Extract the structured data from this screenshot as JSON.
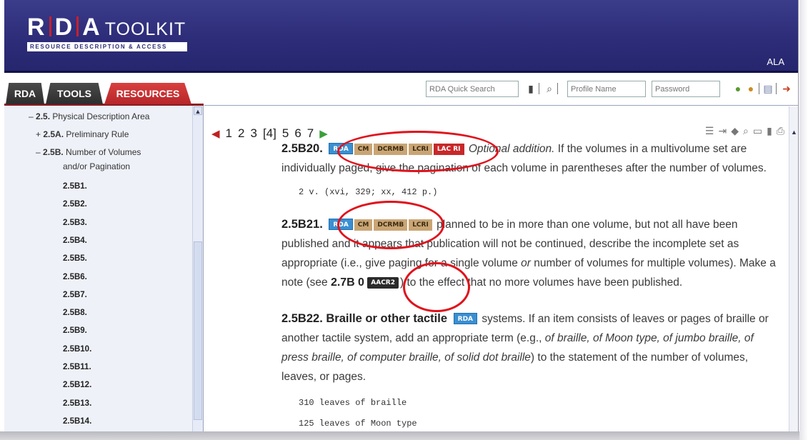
{
  "header": {
    "logo_letter_r": "R",
    "logo_letter_d": "D",
    "logo_letter_a": "A",
    "logo_toolkit": "TOOLKIT",
    "logo_subtitle": "RESOURCE DESCRIPTION & ACCESS",
    "user_org": "ALA",
    "brand_color": "#2c2c79"
  },
  "tabs": [
    {
      "label": "RDA"
    },
    {
      "label": "TOOLS"
    },
    {
      "label": "RESOURCES"
    }
  ],
  "toolbar": {
    "quick_search_placeholder": "RDA Quick Search",
    "profile_placeholder": "Profile Name",
    "password_placeholder": "Password"
  },
  "tree": {
    "section": {
      "prefix": "– ",
      "num": "2.5.",
      "label": " Physical Description Area"
    },
    "rule": {
      "prefix": "+ ",
      "num": "2.5A.",
      "label": " Preliminary Rule"
    },
    "sub": {
      "prefix": "– ",
      "num": "2.5B.",
      "label": " Number of Volumes"
    },
    "sub_cont": "and/or Pagination",
    "rules": [
      "2.5B1.",
      "2.5B2.",
      "2.5B3.",
      "2.5B4.",
      "2.5B5.",
      "2.5B6.",
      "2.5B7.",
      "2.5B8.",
      "2.5B9.",
      "2.5B10.",
      "2.5B11.",
      "2.5B12.",
      "2.5B13.",
      "2.5B14."
    ]
  },
  "pager": {
    "pages": [
      "1",
      "2",
      "3",
      "[4]",
      "5",
      "6",
      "7"
    ]
  },
  "content": {
    "r20": {
      "num": "2.5B20.",
      "badges": [
        "RDA",
        "CM",
        "DCRMB",
        "LCRI",
        "LAC RI"
      ],
      "italic": "Optional addition.",
      "text": " If the volumes in a multivolume set are individually paged, give the pagination of each volume in parentheses after the number of volumes.",
      "example": "2 v. (xvi, 329; xx, 412 p.)"
    },
    "r21": {
      "num": "2.5B21.",
      "badges": [
        "RDA",
        "CM",
        "DCRMB",
        "LCRI"
      ],
      "text_a": " planned to be in more than one volume, but not all have been published and it appears that publication will not be continued, describe the incomplete set as appropriate (i.e., give paging for a single volume ",
      "italic_or": "or",
      "text_b": " number of volumes for multiple volumes). Make a note (see ",
      "ref": "2.7B",
      "ref2": "0",
      "aacr_badge": "AACR2",
      "text_c": ") to the effect that no more volumes have been published."
    },
    "r22": {
      "num": "2.5B22.",
      "heading": " Braille or other tactile",
      "badge": "RDA",
      "text_a": " systems. If an item consists of leaves or pages of braille or another tactile system, add an appropriate term (e.g., ",
      "italic": "of braille, of Moon type, of jumbo braille, of press braille, of computer braille, of solid dot braille",
      "text_b": ") to the statement of the number of volumes, leaves, or pages.",
      "example1": "310 leaves of braille",
      "example2": "125 leaves of Moon type"
    }
  }
}
